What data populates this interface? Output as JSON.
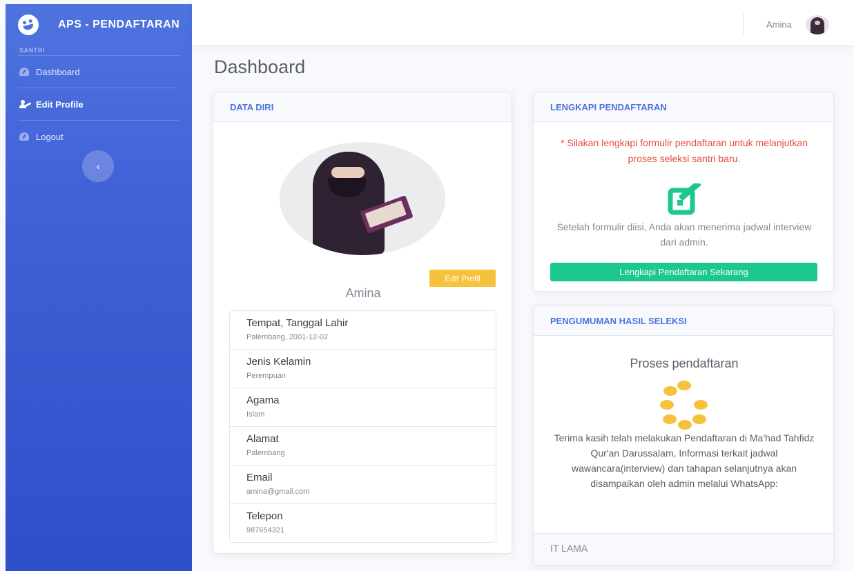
{
  "sidebar": {
    "brand": "APS - PENDAFTARAN",
    "section": "SANTRI",
    "items": [
      {
        "label": "Dashboard",
        "icon": "tachometer-icon"
      },
      {
        "label": "Edit Profile",
        "icon": "user-edit-icon"
      },
      {
        "label": "Logout",
        "icon": "tachometer-icon"
      }
    ],
    "toggle": "‹"
  },
  "topbar": {
    "user_name": "Amina"
  },
  "page_title": "Dashboard",
  "data_diri": {
    "header": "DATA DIRI",
    "edit_button": "Edit Profil",
    "name": "Amina",
    "fields": [
      {
        "label": "Tempat, Tanggal Lahir",
        "value": "Palembang, 2001-12-02"
      },
      {
        "label": "Jenis Kelamin",
        "value": "Perempuan"
      },
      {
        "label": "Agama",
        "value": "Islam"
      },
      {
        "label": "Alamat",
        "value": "Palembang"
      },
      {
        "label": "Email",
        "value": "amina@gmail.com"
      },
      {
        "label": "Telepon",
        "value": "987654321"
      }
    ]
  },
  "lengkapi": {
    "header": "LENGKAPI PENDAFTARAN",
    "warning": "* Silakan lengkapi formulir pendaftaran untuk melanjutkan proses seleksi santri baru.",
    "note": "Setelah formulir diisi, Anda akan menerima jadwal interview dari admin.",
    "button": "Lengkapi Pendaftaran Sekarang"
  },
  "pengumuman": {
    "header": "PENGUMUMAN HASIL SELEKSI",
    "status_title": "Proses pendaftaran",
    "message": "Terima kasih telah melakukan Pendaftaran di Ma'had Tahfidz Qur'an Darussalam, Informasi terkait jadwal wawancara(interview) dan tahapan selanjutnya akan disampaikan oleh admin melalui WhatsApp:",
    "footer": "IT LAMA"
  },
  "colors": {
    "primary": "#4e73df",
    "success": "#1cc88a",
    "warning": "#f6c23e",
    "danger": "#e74a3b"
  }
}
